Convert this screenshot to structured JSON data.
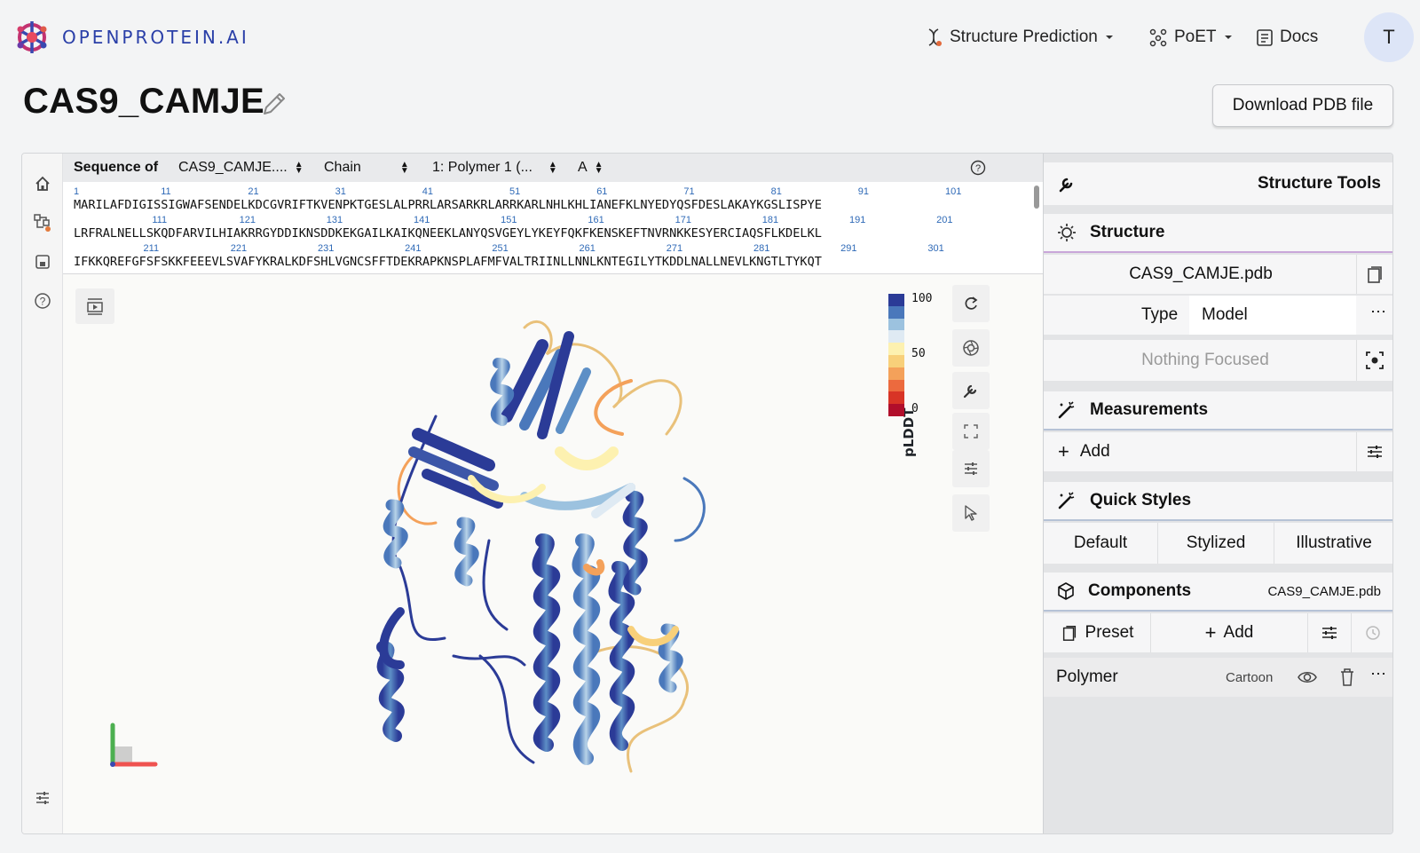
{
  "brand": {
    "name": "OPENPROTEIN.AI"
  },
  "nav": {
    "structure_prediction": "Structure Prediction",
    "poet": "PoET",
    "docs": "Docs",
    "avatar_initial": "T"
  },
  "page": {
    "title": "CAS9_CAMJE",
    "download_button": "Download PDB file"
  },
  "sequence_bar": {
    "label": "Sequence of",
    "structure_select": "CAS9_CAMJE....",
    "mode_select": "Chain",
    "entity_select": "1: Polymer 1 (...",
    "chain_select": "A"
  },
  "sequence": {
    "rows": [
      {
        "text": "MARILAFDIGISSIGWAFSENDELKDCGVRIFTKVENPKTGESLALPRRLARSARKRLARRKARLNHLKHLIANEFKLNYEDYQSFDESLAKAYKGSLISPYE",
        "marks": [
          "1",
          "11",
          "21",
          "31",
          "41",
          "51",
          "61",
          "71",
          "81",
          "91",
          "101"
        ]
      },
      {
        "text": "LRFRALNELLSKQDFARVILHIAKRRGYDDIKNSDDKEKGAILKAIKQNEEKLANYQSVGEYLYKEYFQKFKENSKEFTNVRNKKESYERCIAQSFLKDELKL",
        "marks": [
          "111",
          "121",
          "131",
          "141",
          "151",
          "161",
          "171",
          "181",
          "191",
          "201"
        ]
      },
      {
        "text": "IFKKQREFGFSFSKKFEEEVLSVAFYKRALKDFSHLVGNCSFFTDEKRAPKNSPLAFMFVALTRIINLLNNLKNTEGILYTKDDLNALLNEVLKNGTLTYKQT",
        "marks": [
          "211",
          "221",
          "231",
          "241",
          "251",
          "261",
          "271",
          "281",
          "291",
          "301"
        ]
      }
    ]
  },
  "legend": {
    "title": "pLDDT",
    "max": "100",
    "mid": "50",
    "min": "0",
    "colors": [
      "#2b3b97",
      "#4a78bb",
      "#9cc2df",
      "#dfeaf3",
      "#fdf1b0",
      "#f8d07a",
      "#f4a15a",
      "#ec6a3e",
      "#d83426",
      "#b10e2b"
    ]
  },
  "panel": {
    "title": "Structure Tools",
    "structure": {
      "heading": "Structure",
      "file": "CAS9_CAMJE.pdb",
      "type_label": "Type",
      "type_value": "Model",
      "focus": "Nothing Focused"
    },
    "measurements": {
      "heading": "Measurements",
      "add": "Add"
    },
    "quick_styles": {
      "heading": "Quick Styles",
      "options": [
        "Default",
        "Stylized",
        "Illustrative"
      ]
    },
    "components": {
      "heading": "Components",
      "file": "CAS9_CAMJE.pdb",
      "preset": "Preset",
      "add": "Add"
    },
    "polymer": {
      "name": "Polymer",
      "repr": "Cartoon"
    }
  }
}
